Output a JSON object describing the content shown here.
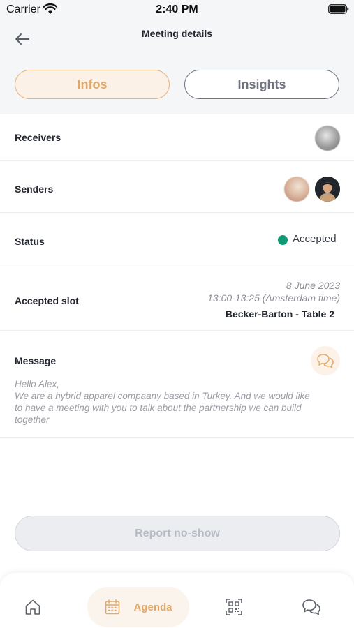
{
  "status_bar": {
    "carrier": "Carrier",
    "time": "2:40 PM"
  },
  "header": {
    "title": "Meeting details"
  },
  "tabs": [
    {
      "label": "Infos",
      "active": true
    },
    {
      "label": "Insights",
      "active": false
    }
  ],
  "rows": {
    "receivers": {
      "label": "Receivers"
    },
    "senders": {
      "label": "Senders"
    },
    "status": {
      "label": "Status",
      "value": "Accepted",
      "color": "#0f9874"
    },
    "accepted_slot": {
      "label": "Accepted slot",
      "date": "8 June 2023",
      "time": "13:00-13:25 (Amsterdam time)",
      "table": "Becker-Barton - Table 2"
    },
    "message": {
      "label": "Message",
      "text": "Hello Alex,\nWe are a hybrid apparel compaany based in Turkey. And we would like to have a meeting with you to talk about the partnership we can build together"
    }
  },
  "actions": {
    "report_label": "Report no-show"
  },
  "tab_bar": {
    "items": [
      {
        "icon": "home-icon"
      },
      {
        "icon": "calendar-icon",
        "label": "Agenda",
        "active": true
      },
      {
        "icon": "qr-code-icon"
      },
      {
        "icon": "chat-icon"
      }
    ]
  },
  "colors": {
    "accent": "#e0a86b",
    "accent_bg": "#fbf1e6",
    "status_accepted": "#0f9874"
  }
}
